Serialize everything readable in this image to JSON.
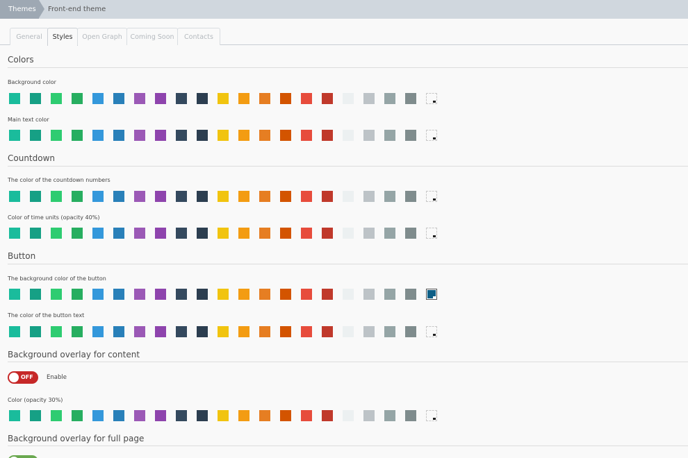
{
  "breadcrumb": {
    "root": "Themes",
    "current": "Front-end theme"
  },
  "tabs": [
    {
      "label": "General",
      "active": false
    },
    {
      "label": "Styles",
      "active": true
    },
    {
      "label": "Open Graph",
      "active": false
    },
    {
      "label": "Coming Soon",
      "active": false
    },
    {
      "label": "Contacts",
      "active": false
    }
  ],
  "palette": [
    "#1abc9c",
    "#16a085",
    "#2ecc71",
    "#27ae60",
    "#3498db",
    "#2980b9",
    "#9b59b6",
    "#8e44ad",
    "#34495e",
    "#2c3e50",
    "#f1c40f",
    "#f39c12",
    "#e67e22",
    "#d35400",
    "#e74c3c",
    "#c0392b",
    "#ecf0f1",
    "#bdc3c7",
    "#95a5a6",
    "#7f8c8d"
  ],
  "sections": {
    "colors": {
      "title": "Colors",
      "background_color": {
        "label": "Background color"
      },
      "main_text_color": {
        "label": "Main text color"
      }
    },
    "countdown": {
      "title": "Countdown",
      "numbers_color": {
        "label": "The color of the countdown numbers"
      },
      "units_color": {
        "label": "Color of time units (opacity 40%)"
      }
    },
    "button": {
      "title": "Button",
      "background_color": {
        "label": "The background color of the button",
        "custom_color": "#0e5f86",
        "custom_selected": true
      },
      "text_color": {
        "label": "The color of the button text"
      }
    },
    "overlay_content": {
      "title": "Background overlay for content",
      "toggle_state": "OFF",
      "toggle_color": "#c62828",
      "enable_label": "Enable",
      "color": {
        "label": "Color (opacity 30%)"
      }
    },
    "overlay_full": {
      "title": "Background overlay for full page",
      "toggle_color": "#6aa84f"
    }
  }
}
